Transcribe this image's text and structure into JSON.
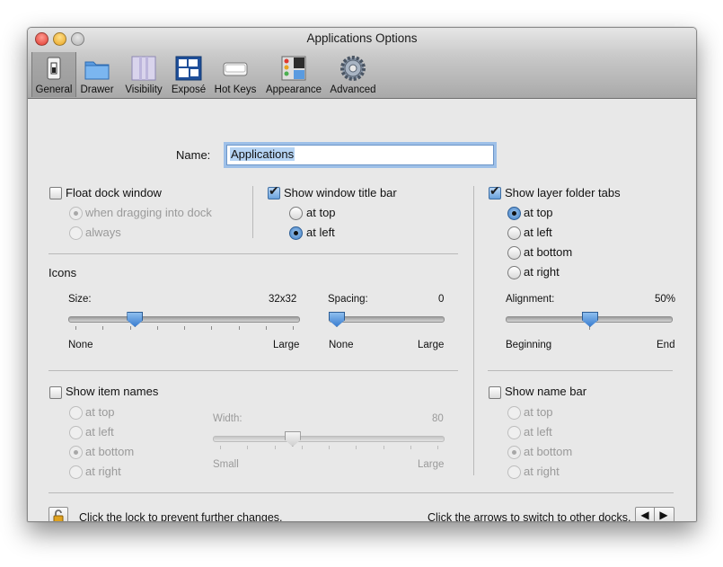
{
  "window": {
    "title": "Applications Options"
  },
  "toolbar": {
    "items": [
      {
        "label": "General",
        "icon": "switch-icon",
        "selected": true
      },
      {
        "label": "Drawer",
        "icon": "folder-icon"
      },
      {
        "label": "Visibility",
        "icon": "visibility-icon"
      },
      {
        "label": "Exposé",
        "icon": "expose-icon"
      },
      {
        "label": "Hot Keys",
        "icon": "keyboard-key-icon"
      },
      {
        "label": "Appearance",
        "icon": "appearance-icon"
      },
      {
        "label": "Advanced",
        "icon": "gear-icon"
      }
    ]
  },
  "name_field": {
    "label": "Name:",
    "value": "Applications"
  },
  "float_dock": {
    "label": "Float dock window",
    "checked": false,
    "options": [
      {
        "label": "when dragging into dock",
        "selected": true
      },
      {
        "label": "always",
        "selected": false
      }
    ]
  },
  "title_bar": {
    "label": "Show window title bar",
    "checked": true,
    "options": [
      {
        "label": "at top",
        "selected": false
      },
      {
        "label": "at left",
        "selected": true
      }
    ]
  },
  "layer_tabs": {
    "label": "Show layer folder tabs",
    "checked": true,
    "options": [
      {
        "label": "at top",
        "selected": true
      },
      {
        "label": "at left",
        "selected": false
      },
      {
        "label": "at bottom",
        "selected": false
      },
      {
        "label": "at right",
        "selected": false
      }
    ]
  },
  "icons": {
    "heading": "Icons",
    "size": {
      "label": "Size:",
      "value": "32x32",
      "min_label": "None",
      "max_label": "Large",
      "level": 0.27
    },
    "spacing": {
      "label": "Spacing:",
      "value": "0",
      "min_label": "None",
      "max_label": "Large",
      "level": 0.0
    }
  },
  "alignment": {
    "label": "Alignment:",
    "value": "50%",
    "min_label": "Beginning",
    "max_label": "End",
    "level": 0.5
  },
  "item_names": {
    "label": "Show item names",
    "checked": false,
    "options": [
      {
        "label": "at top",
        "selected": false
      },
      {
        "label": "at left",
        "selected": false
      },
      {
        "label": "at bottom",
        "selected": true
      },
      {
        "label": "at right",
        "selected": false
      }
    ],
    "width": {
      "label": "Width:",
      "value": "80",
      "min_label": "Small",
      "max_label": "Large",
      "level": 0.33
    }
  },
  "name_bar": {
    "label": "Show name bar",
    "checked": false,
    "options": [
      {
        "label": "at top",
        "selected": false
      },
      {
        "label": "at left",
        "selected": false
      },
      {
        "label": "at bottom",
        "selected": true
      },
      {
        "label": "at right",
        "selected": false
      }
    ]
  },
  "footer": {
    "lock_text": "Click the lock to prevent further changes.",
    "arrows_text": "Click the arrows to switch to other docks.",
    "prev": "◀",
    "next": "▶"
  }
}
